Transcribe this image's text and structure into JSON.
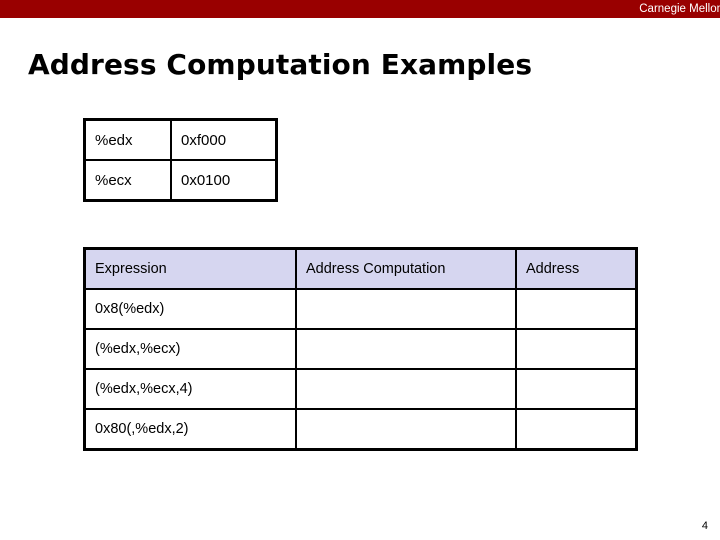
{
  "banner": {
    "institution": "Carnegie Mellon",
    "color": "#990000"
  },
  "slide": {
    "title": "Address Computation Examples",
    "page_number": "4"
  },
  "register_table": {
    "rows": [
      {
        "register": "%edx",
        "value": "0xf000"
      },
      {
        "register": "%ecx",
        "value": "0x0100"
      }
    ]
  },
  "expression_table": {
    "header_color": "#d6d6f0",
    "columns": [
      {
        "label": "Expression"
      },
      {
        "label": "Address Computation"
      },
      {
        "label": "Address"
      }
    ],
    "rows": [
      {
        "expression": "0x8(%edx)",
        "address_computation": "",
        "address": ""
      },
      {
        "expression": "(%edx,%ecx)",
        "address_computation": "",
        "address": ""
      },
      {
        "expression": "(%edx,%ecx,4)",
        "address_computation": "",
        "address": ""
      },
      {
        "expression": "0x80(,%edx,2)",
        "address_computation": "",
        "address": ""
      }
    ]
  }
}
